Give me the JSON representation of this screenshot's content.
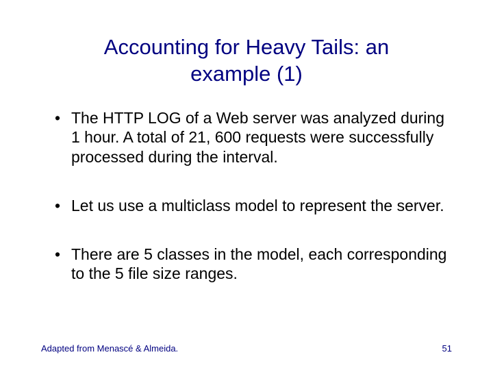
{
  "title": "Accounting for Heavy Tails: an example (1)",
  "bullets": [
    "The HTTP LOG of a Web server was analyzed during 1 hour. A total of 21, 600 requests were successfully processed during the interval.",
    "Let us use a multiclass model to represent the server.",
    "There are 5 classes in the model, each corresponding to the 5 file size ranges."
  ],
  "footer": "Adapted from Menascé & Almeida.",
  "page_number": "51"
}
